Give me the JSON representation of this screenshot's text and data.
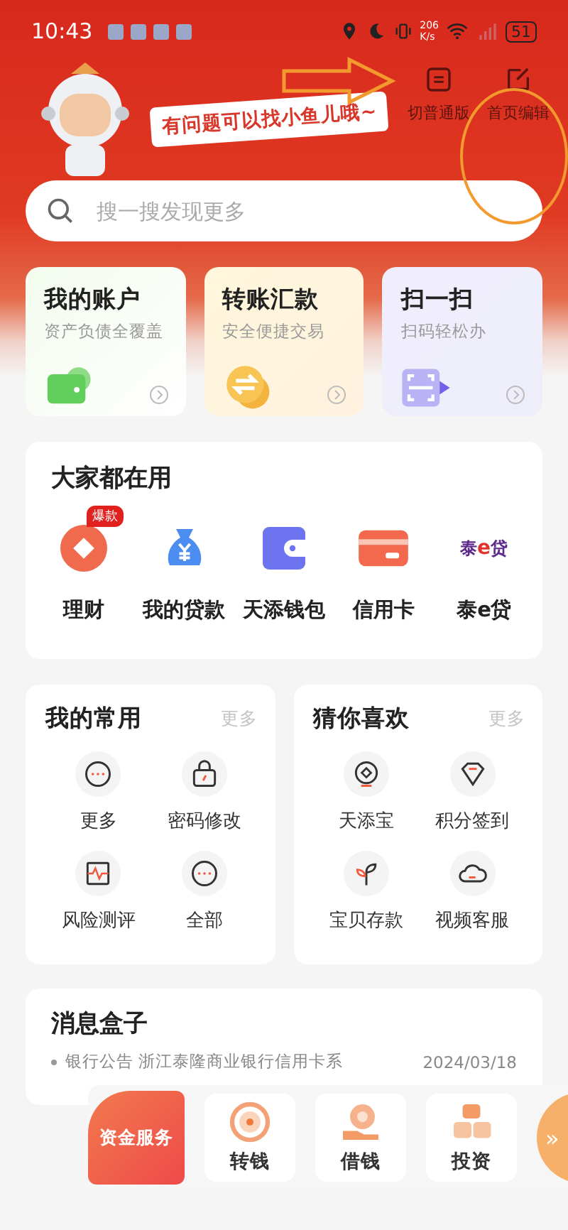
{
  "status_bar": {
    "time": "10:43",
    "net_speed_value": "206",
    "net_speed_unit": "K/s",
    "battery": "51"
  },
  "header": {
    "speech_bubble": "有问题可以找小鱼儿哦~",
    "actions": [
      {
        "label": "切普通版",
        "kind": "switch"
      },
      {
        "label": "首页编辑",
        "kind": "edit"
      }
    ]
  },
  "search": {
    "placeholder": "搜一搜发现更多"
  },
  "quick_cards": [
    {
      "title": "我的账户",
      "subtitle": "资产负债全覆盖",
      "kind": "wallet"
    },
    {
      "title": "转账汇款",
      "subtitle": "安全便捷交易",
      "kind": "transfer"
    },
    {
      "title": "扫一扫",
      "subtitle": "扫码轻松办",
      "kind": "scan"
    }
  ],
  "popular": {
    "title": "大家都在用",
    "items": [
      {
        "label": "理财",
        "kind": "coin",
        "badge": "爆款"
      },
      {
        "label": "我的贷款",
        "kind": "moneybag"
      },
      {
        "label": "天添钱包",
        "kind": "wallet"
      },
      {
        "label": "信用卡",
        "kind": "card"
      },
      {
        "label": "泰e贷",
        "kind": "logo",
        "logo_left": "泰",
        "logo_mid": "e",
        "logo_right": "贷"
      }
    ]
  },
  "panels": [
    {
      "title": "我的常用",
      "more": "更多",
      "items": [
        {
          "label": "更多",
          "kind": "dots"
        },
        {
          "label": "密码修改",
          "kind": "lock"
        },
        {
          "label": "风险测评",
          "kind": "pulse"
        },
        {
          "label": "全部",
          "kind": "dots"
        }
      ]
    },
    {
      "title": "猜你喜欢",
      "more": "更多",
      "items": [
        {
          "label": "天添宝",
          "kind": "coin"
        },
        {
          "label": "积分签到",
          "kind": "gem"
        },
        {
          "label": "宝贝存款",
          "kind": "sprout"
        },
        {
          "label": "视频客服",
          "kind": "cloud"
        }
      ]
    }
  ],
  "messages": {
    "title": "消息盒子",
    "items": [
      {
        "text": "银行公告  浙江泰隆商业银行信用卡系",
        "date": "2024/03/18"
      }
    ]
  },
  "fund_service": {
    "label": "资金服务",
    "items": [
      {
        "label": "转钱",
        "kind": "transfer"
      },
      {
        "label": "借钱",
        "kind": "borrow"
      },
      {
        "label": "投资",
        "kind": "invest"
      }
    ],
    "more": "»"
  }
}
